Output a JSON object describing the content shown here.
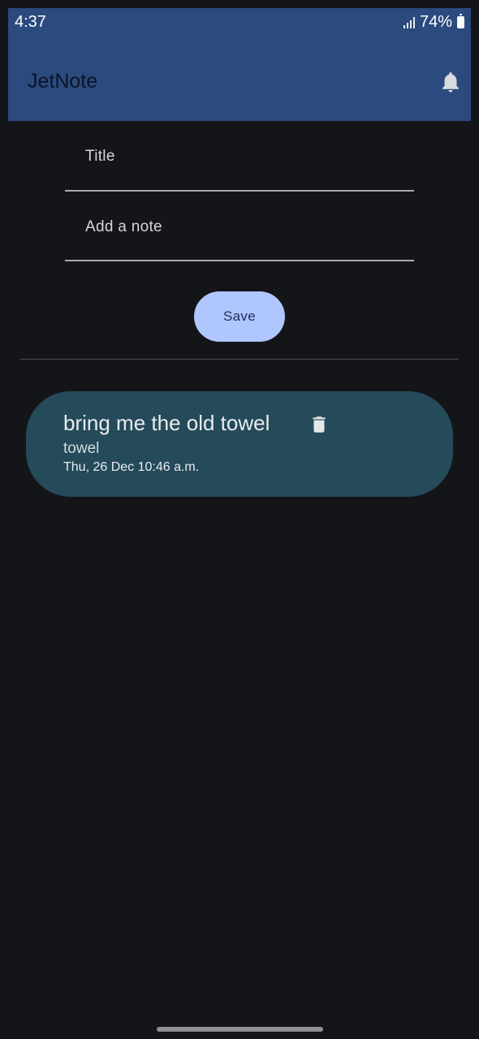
{
  "status_bar": {
    "time": "4:37",
    "battery": "74%"
  },
  "app_bar": {
    "title": "JetNote",
    "action_icon": "bell-icon"
  },
  "form": {
    "title_label": "Title",
    "note_label": "Add a note",
    "save_label": "Save"
  },
  "notes": [
    {
      "title": "bring me the old towel",
      "text": "towel",
      "date": "Thu, 26 Dec 10:46 a.m.",
      "action_icon": "trash-icon"
    }
  ],
  "colors": {
    "app_bar": "#2b4a7d",
    "background": "#141518",
    "save_button": "#afc6ff",
    "note_card": "#254a5a"
  }
}
